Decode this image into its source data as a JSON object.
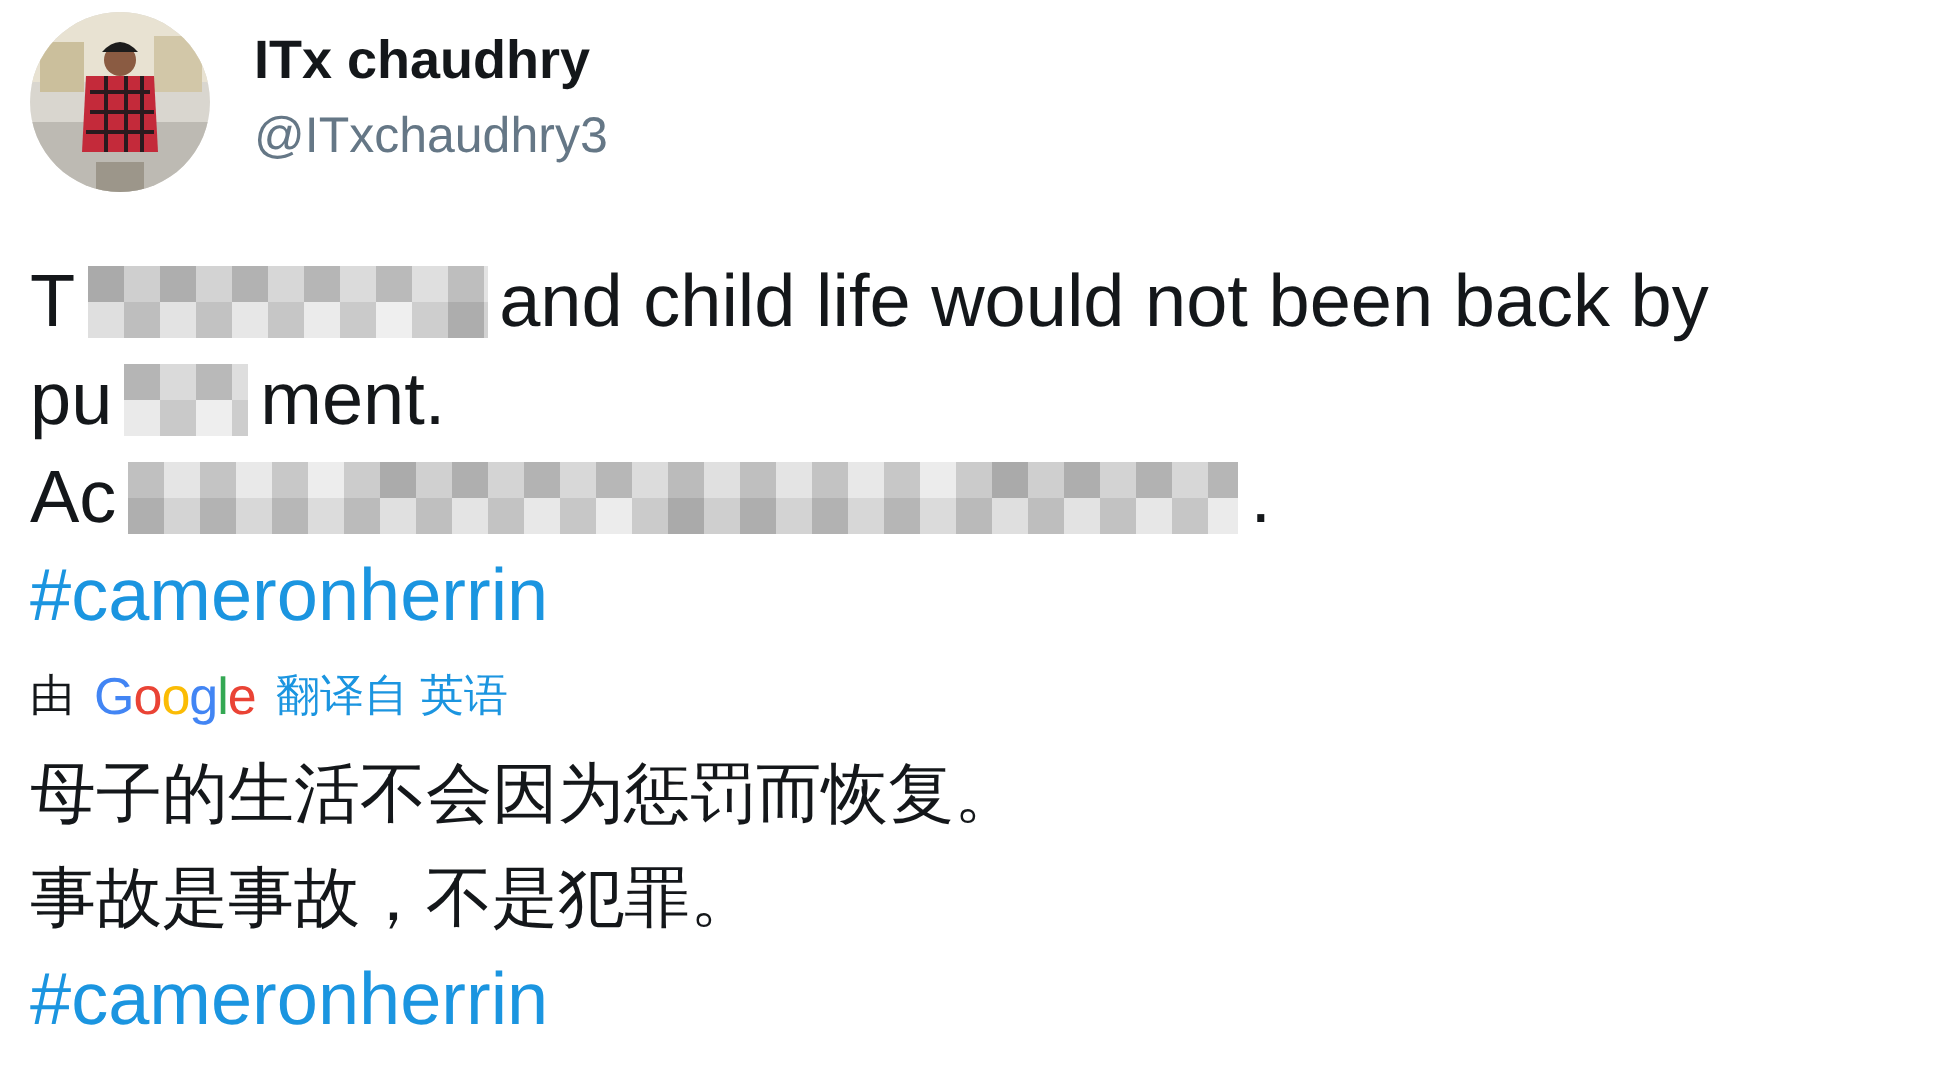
{
  "author": {
    "name": "ITx chaudhry",
    "handle": "@ITxchaudhry3"
  },
  "text_lines": [
    {
      "parts": [
        {
          "kind": "text",
          "text": "T"
        },
        {
          "kind": "blur"
        },
        {
          "kind": "text",
          "text": "and child life would not been back by"
        }
      ]
    },
    {
      "parts": [
        {
          "kind": "text",
          "text": "pu"
        },
        {
          "kind": "blur"
        },
        {
          "kind": "text",
          "text": "ment."
        }
      ]
    },
    {
      "parts": [
        {
          "kind": "text",
          "text": "Ac"
        },
        {
          "kind": "blur"
        },
        {
          "kind": "text",
          "text": "."
        }
      ]
    }
  ],
  "hashtag": "#cameronherrin",
  "translation": {
    "prefix": "由",
    "provider": "Google",
    "label": "翻译自 英语"
  },
  "translated_lines": [
    "母子的生活不会因为惩罚而恢复。",
    "事故是事故，不是犯罪。"
  ],
  "translated_hashtag": "#cameronherrin"
}
